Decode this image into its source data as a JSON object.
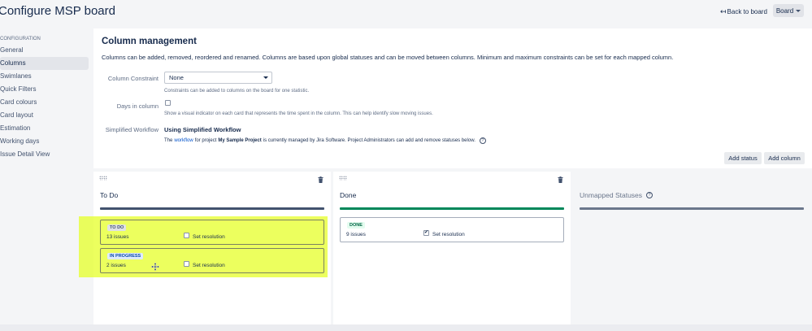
{
  "header": {
    "title": "Configure MSP board",
    "back_link": "Back to board",
    "board_button": "Board"
  },
  "sidebar": {
    "heading": "CONFIGURATION",
    "items": [
      {
        "label": "General"
      },
      {
        "label": "Columns",
        "selected": true
      },
      {
        "label": "Swimlanes"
      },
      {
        "label": "Quick Filters"
      },
      {
        "label": "Card colours"
      },
      {
        "label": "Card layout"
      },
      {
        "label": "Estimation"
      },
      {
        "label": "Working days"
      },
      {
        "label": "Issue Detail View"
      }
    ]
  },
  "main": {
    "title": "Column management",
    "description": "Columns can be added, removed, reordered and renamed. Columns are based upon global statuses and can be moved between columns. Minimum and maximum constraints can be set for each mapped column.",
    "constraint": {
      "label": "Column Constraint",
      "value": "None",
      "help": "Constraints can be added to columns on the board for one statistic."
    },
    "days": {
      "label": "Days in column",
      "checked": false,
      "help": "Show a visual indicator on each card that represents the time spent in the column. This can help identify slow moving issues."
    },
    "workflow": {
      "label": "Simplified Workflow",
      "value": "Using Simplified Workflow",
      "text_the": "The",
      "link": "workflow",
      "text_for": "for project",
      "project": "My Sample Project",
      "text_rest": "is currently managed by Jira Software. Project Administrators can add and remove statuses below."
    },
    "buttons": {
      "add_status": "Add status",
      "add_column": "Add column"
    }
  },
  "columns": [
    {
      "name": "To Do",
      "bar_color": "#42526e",
      "statuses": [
        {
          "lozenge": "TO DO",
          "issues": "13 issues",
          "resolution": "Set resolution",
          "checked": false,
          "lozenge_bg": "#dfe1e6",
          "lozenge_fg": "#42526e"
        },
        {
          "lozenge": "IN PROGRESS",
          "issues": "2 issues",
          "resolution": "Set resolution",
          "checked": false,
          "lozenge_bg": "#deebff",
          "lozenge_fg": "#0747a6"
        }
      ]
    },
    {
      "name": "Done",
      "bar_color": "#00875a",
      "statuses": [
        {
          "lozenge": "DONE",
          "issues": "9 issues",
          "resolution": "Set resolution",
          "checked": true,
          "lozenge_bg": "#e3fcef",
          "lozenge_fg": "#006644"
        }
      ]
    }
  ],
  "unmapped": {
    "name": "Unmapped Statuses",
    "bar_color": "#6b778c"
  },
  "colors": {
    "highlight": "#e5ff28",
    "link": "#0052cc"
  },
  "icons": {
    "back": "arrow-left-icon",
    "caret": "chevron-down-icon",
    "trash": "trash-icon",
    "grip": "drag-handle-icon",
    "help": "question-circle-icon",
    "cursor": "move-cursor-icon"
  }
}
